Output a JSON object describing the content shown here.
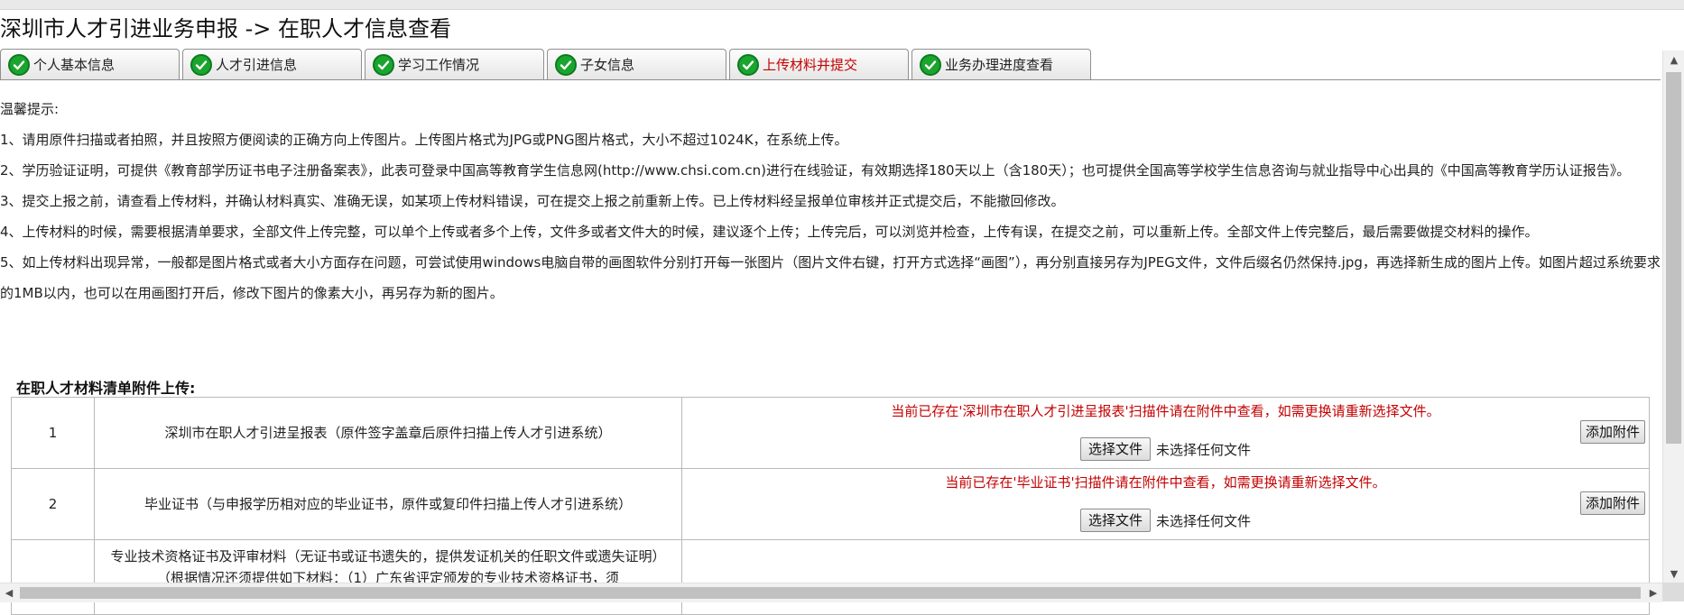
{
  "page_title": "深圳市人才引进业务申报 -> 在职人才信息查看",
  "tabs": [
    {
      "label": "个人基本信息",
      "active": false
    },
    {
      "label": "人才引进信息",
      "active": false
    },
    {
      "label": "学习工作情况",
      "active": false
    },
    {
      "label": "子女信息",
      "active": false
    },
    {
      "label": "上传材料并提交",
      "active": true
    },
    {
      "label": "业务办理进度查看",
      "active": false
    }
  ],
  "notes": {
    "heading": "温馨提示:",
    "items": [
      "1、请用原件扫描或者拍照，并且按照方便阅读的正确方向上传图片。上传图片格式为JPG或PNG图片格式，大小不超过1024K，在系统上传。",
      "2、学历验证证明，可提供《教育部学历证书电子注册备案表》，此表可登录中国高等教育学生信息网(http://www.chsi.com.cn)进行在线验证，有效期选择180天以上（含180天）；也可提供全国高等学校学生信息咨询与就业指导中心出具的《中国高等教育学历认证报告》。",
      "3、提交上报之前，请查看上传材料，并确认材料真实、准确无误，如某项上传材料错误，可在提交上报之前重新上传。已上传材料经呈报单位审核并正式提交后，不能撤回修改。",
      "4、上传材料的时候，需要根据清单要求，全部文件上传完整，可以单个上传或者多个上传，文件多或者文件大的时候，建议逐个上传；上传完后，可以浏览并检查，上传有误，在提交之前，可以重新上传。全部文件上传完整后，最后需要做提交材料的操作。",
      "5、如上传材料出现异常，一般都是图片格式或者大小方面存在问题，可尝试使用windows电脑自带的画图软件分别打开每一张图片（图片文件右键，打开方式选择“画图”），再分别直接另存为JPEG文件，文件后缀名仍然保持.jpg，再选择新生成的图片上传。如图片超过系统要求的1MB以内，也可以在用画图打开后，修改下图片的像素大小，再另存为新的图片。"
    ]
  },
  "section_title": "在职人才材料清单附件上传:",
  "uploads": [
    {
      "no": "1",
      "name": "深圳市在职人才引进呈报表（原件签字盖章后原件扫描上传人才引进系统）",
      "notice": "当前已存在'深圳市在职人才引进呈报表'扫描件请在附件中查看，如需更换请重新选择文件。",
      "choose_label": "选择文件",
      "no_file_label": "未选择任何文件",
      "add_label": "添加附件"
    },
    {
      "no": "2",
      "name": "毕业证书（与申报学历相对应的毕业证书，原件或复印件扫描上传人才引进系统）",
      "notice": "当前已存在'毕业证书'扫描件请在附件中查看，如需更换请重新选择文件。",
      "choose_label": "选择文件",
      "no_file_label": "未选择任何文件",
      "add_label": "添加附件"
    },
    {
      "no": "",
      "name": "专业技术资格证书及评审材料（无证书或证书遗失的，提供发证机关的任职文件或遗失证明）（根据情况还须提供如下材料：（1）广东省评定颁发的专业技术资格证书，须",
      "notice": "",
      "choose_label": "",
      "no_file_label": "",
      "add_label": ""
    }
  ],
  "colors": {
    "accent_red": "#c40000",
    "check_green": "#1aa52e"
  }
}
